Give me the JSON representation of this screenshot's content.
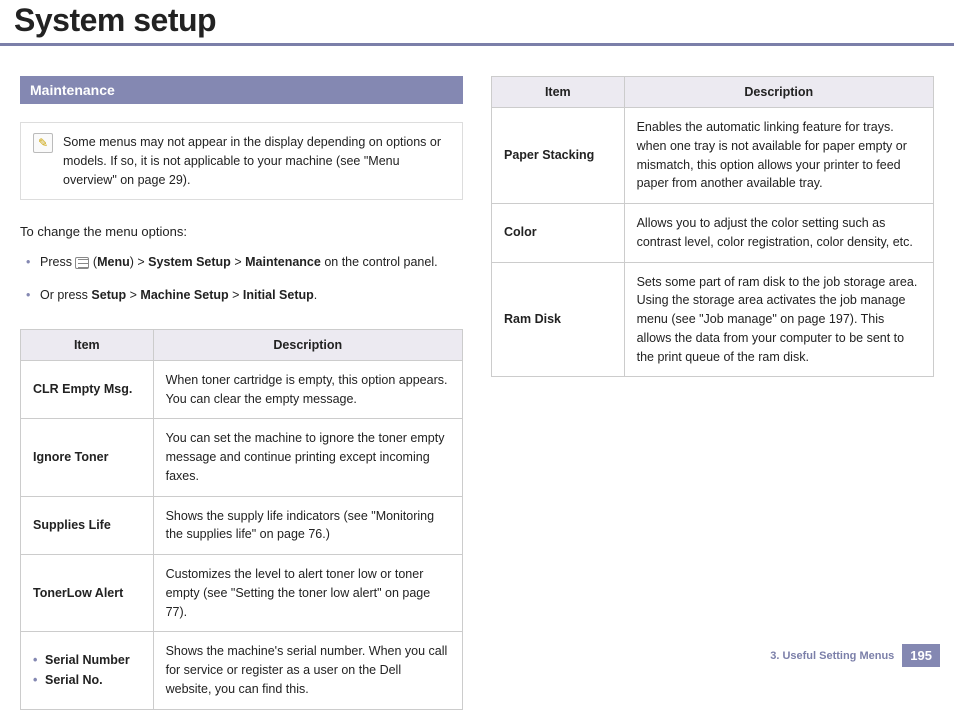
{
  "header": {
    "title": "System setup"
  },
  "section": {
    "heading": "Maintenance"
  },
  "note": {
    "icon": "✎",
    "text": "Some menus may not appear in the display depending on options or models. If so, it is not applicable to your machine (see \"Menu overview\" on page 29)."
  },
  "intro": "To change the menu options:",
  "breadcrumb": {
    "bullet1_prefix": "Press ",
    "menu_label": "Menu",
    "gt": ">",
    "sys_setup": "System Setup",
    "maintenance": "Maintenance",
    "suffix": " on the control panel.",
    "bullet2_prefix": "Or press ",
    "setup": "Setup",
    "machine_setup": "Machine Setup",
    "initial_setup": "Initial Setup",
    "period": "."
  },
  "table_headers": {
    "item": "Item",
    "description": "Description"
  },
  "left_rows": [
    {
      "item": "CLR Empty Msg.",
      "desc": "When toner cartridge is empty, this option appears. You can clear the empty message."
    },
    {
      "item": "Ignore Toner",
      "desc": "You can set the machine to ignore the toner empty message and continue printing except incoming faxes."
    },
    {
      "item": "Supplies Life",
      "desc": "Shows the supply life indicators (see \"Monitoring the supplies life\" on page 76.)"
    },
    {
      "item": "TonerLow Alert",
      "desc": "Customizes the level to alert toner low or toner empty (see \"Setting the toner low alert\" on page 77)."
    },
    {
      "item_list": [
        "Serial Number",
        "Serial No."
      ],
      "desc": "Shows the machine's serial number. When you call for service or register as a user on the Dell website, you can find this."
    }
  ],
  "right_rows": [
    {
      "item": "Paper Stacking",
      "desc": "Enables the automatic linking feature for trays. when one tray is not available for paper empty or mismatch, this option allows your printer to feed paper from another available tray."
    },
    {
      "item": "Color",
      "desc": "Allows you to adjust the color setting such as contrast level, color registration, color density, etc."
    },
    {
      "item": "Ram Disk",
      "desc": "Sets some part of ram disk to the job storage area. Using the storage area activates the job manage menu (see \"Job manage\" on page 197). This allows the data from your computer to be sent to the print queue of the ram disk."
    }
  ],
  "footer": {
    "chapter": "3.  Useful Setting Menus",
    "page": "195"
  }
}
